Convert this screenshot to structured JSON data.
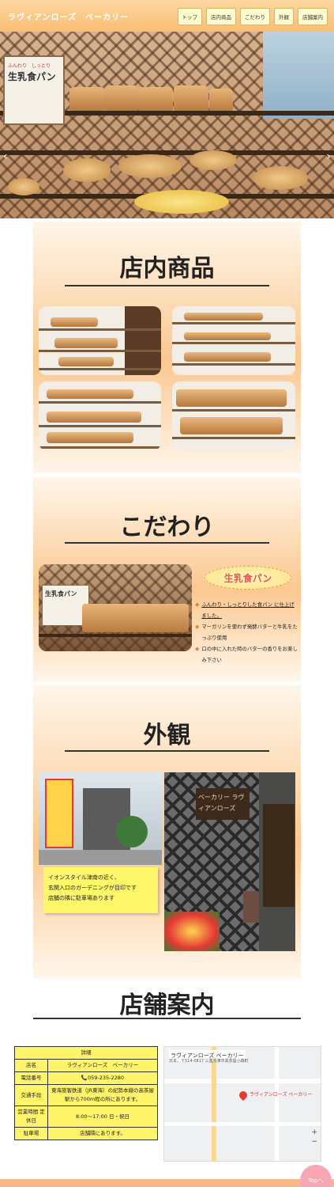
{
  "header": {
    "site_title": "ラヴィアンローズ　ベーカリー",
    "nav": [
      "トップ",
      "店内商品",
      "こだわり",
      "外観",
      "店舗案内"
    ]
  },
  "hero": {
    "sign_top": "ふんわり　しっとり",
    "sign_main": "生乳食パン"
  },
  "sections": {
    "products": {
      "title": "店内商品"
    },
    "kodawari": {
      "title": "こだわり",
      "photo_sign": "生乳食パン",
      "label": "生乳食パン",
      "items": [
        "ふんわり・しっとりした食パン に仕上げました。",
        "マーガリンを使わず発酵バターと牛乳をたっぷり使用",
        "口の中に入れた時のバターの香りをお楽しみ下さい"
      ]
    },
    "exterior": {
      "title": "外観",
      "shop_sign": "ベーカリー ラヴィアンローズ",
      "note": [
        "イオンスタイル津南の近く、",
        "玄関入口のガーデニングが目印です",
        "店舗の隣に駐車場あります"
      ]
    }
  },
  "store_info": {
    "title": "店舗案内",
    "table_header": "詳細",
    "rows": [
      {
        "key": "店名",
        "value": "ラヴィアンローズ　ベーカリー"
      },
      {
        "key": "電話番号",
        "value": "📞059-235-2280"
      },
      {
        "key": "交通手段",
        "value": "東海旅客鉄道（JR東海）の紀勢本線の高茶屋駅から700m程の所にあります。"
      },
      {
        "key": "営業時間 定休日",
        "value": "8:00〜17:00 日・祝日"
      },
      {
        "key": "駐車場",
        "value": "店舗隣にあります。"
      }
    ],
    "map": {
      "title": "ラヴィアンローズ ベーカリー",
      "address": "日本、〒514-0817 三重県津市高茶屋小森町",
      "place_label": "ラヴィアンローズ ベーカリー",
      "zoom_in": "+",
      "zoom_out": "−"
    }
  },
  "top_button": "Topへ"
}
